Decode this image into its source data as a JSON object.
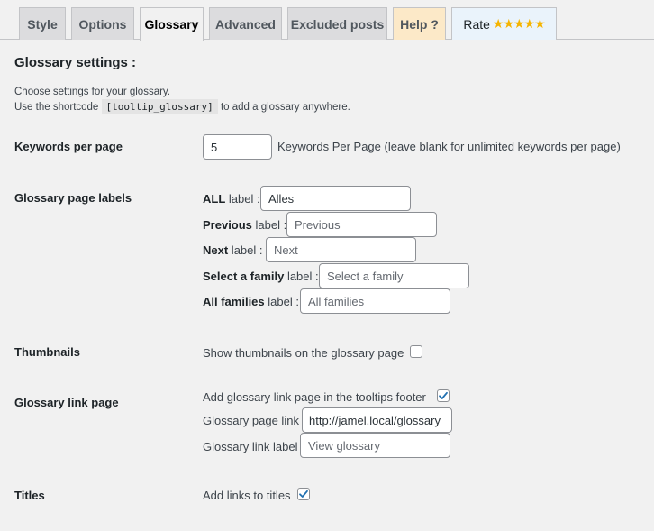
{
  "tabs": [
    {
      "label": "Style"
    },
    {
      "label": "Options"
    },
    {
      "label": "Glossary"
    },
    {
      "label": "Advanced"
    },
    {
      "label": "Excluded posts"
    },
    {
      "label": "Help ?"
    },
    {
      "label": "Rate"
    }
  ],
  "rate_stars": "★★★★★",
  "heading": "Glossary settings :",
  "intro": {
    "line1": "Choose settings for your glossary.",
    "line2_before": "Use the shortcode",
    "shortcode": "[tooltip_glossary]",
    "line2_after": "to add a glossary anywhere."
  },
  "keywords": {
    "label": "Keywords per page",
    "value": "5",
    "hint": "Keywords Per Page (leave blank for unlimited keywords per page)"
  },
  "labels_section": {
    "label": "Glossary page labels",
    "all": {
      "bold": "ALL",
      "suffix": " label :",
      "value": "Alles"
    },
    "previous": {
      "bold": "Previous",
      "suffix": " label :",
      "placeholder": "Previous"
    },
    "next": {
      "bold": "Next",
      "suffix": " label :",
      "placeholder": "Next"
    },
    "family": {
      "bold": "Select a family",
      "suffix": " label :",
      "placeholder": "Select a family"
    },
    "families": {
      "bold": "All families",
      "suffix": " label :",
      "placeholder": "All families"
    }
  },
  "thumbnails": {
    "label": "Thumbnails",
    "text": "Show thumbnails on the glossary page",
    "checked": false
  },
  "link_page": {
    "label": "Glossary link page",
    "footer_text": "Add glossary link page in the tooltips footer",
    "footer_checked": true,
    "page_link_label": "Glossary page link",
    "page_link_value": "http://jamel.local/glossary",
    "link_label_label": "Glossary link label",
    "link_label_placeholder": "View glossary"
  },
  "titles": {
    "label": "Titles",
    "text": "Add links to titles",
    "checked": true
  }
}
